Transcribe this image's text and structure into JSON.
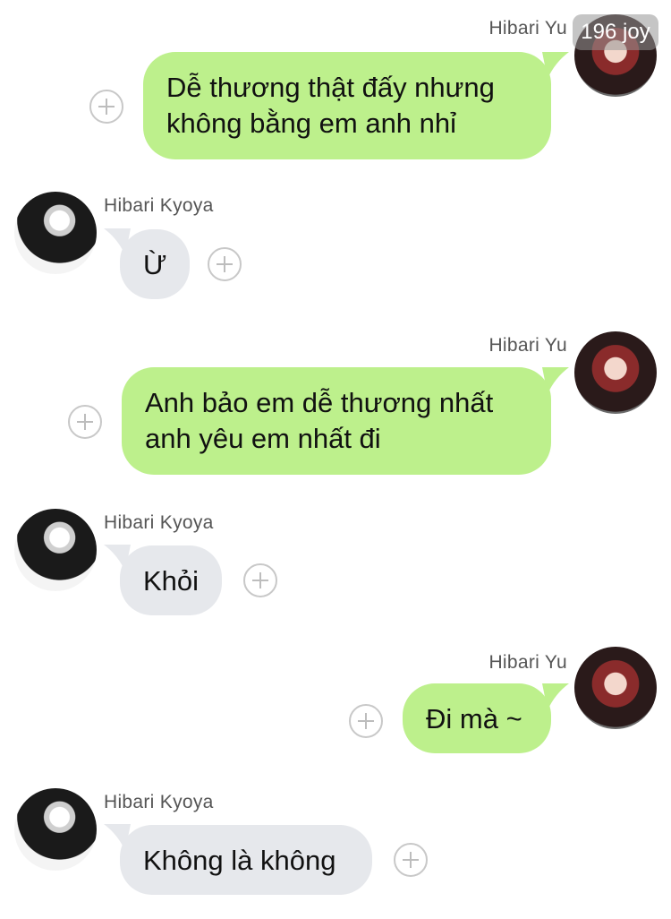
{
  "watermark": "196 joy",
  "messages": [
    {
      "side": "out",
      "sender": "Hibari Yu",
      "lines": [
        "Dễ thương thật đấy nhưng",
        "không bằng em anh nhỉ"
      ]
    },
    {
      "side": "in",
      "sender": "Hibari Kyoya",
      "lines": [
        "Ừ"
      ]
    },
    {
      "side": "out",
      "sender": "Hibari Yu",
      "lines": [
        "Anh bảo em dễ thương nhất",
        "anh yêu em nhất đi"
      ]
    },
    {
      "side": "in",
      "sender": "Hibari Kyoya",
      "lines": [
        "Khỏi"
      ]
    },
    {
      "side": "out",
      "sender": "Hibari Yu",
      "lines": [
        "Đi mà ~"
      ]
    },
    {
      "side": "in",
      "sender": "Hibari Kyoya",
      "lines": [
        "Không là không"
      ]
    }
  ],
  "colors": {
    "outgoing_bubble": "#bdf08c",
    "incoming_bubble": "#e6e8ec",
    "name_text": "#555555"
  }
}
